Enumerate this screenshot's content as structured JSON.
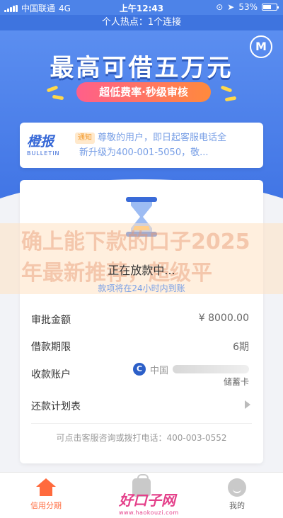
{
  "status_bar": {
    "carrier": "中国联通",
    "network": "4G",
    "time": "上午12:43",
    "battery": "53%"
  },
  "hotspot": "个人热点：1个连接",
  "banner": {
    "title": "最高可借五万元",
    "subtitle": "超低费率·秒级审核",
    "logo_letter": "M"
  },
  "bulletin": {
    "brand": "橙报",
    "brand_en": "BULLETIN",
    "tag": "通知",
    "text_line1": "尊敬的用户，即日起客服电话全",
    "text_line2": "新升级为400-001-5050，敬..."
  },
  "watermark": "确上能下款的口子2025年最新推荐，超级平",
  "loan": {
    "status": "正在放款中...",
    "subtitle": "款项将在24小时内到账",
    "amount_label": "审批金额",
    "amount_value": "¥ 8000.00",
    "term_label": "借款期限",
    "term_value": "6期",
    "account_label": "收款账户",
    "account_bank": "中国",
    "account_type": "储蓄卡",
    "plan_label": "还款计划表",
    "service_text": "可点击客服咨询或拨打电话：400-003-0552"
  },
  "tabs": [
    {
      "label": "信用分期",
      "icon": "house-icon",
      "active": true
    },
    {
      "label": "",
      "icon": "bag-icon",
      "active": false
    },
    {
      "label": "我的",
      "icon": "face-icon",
      "active": false
    }
  ],
  "site_logo": {
    "text": "好口子网",
    "url_text": "www.haokouzi.com"
  },
  "colors": {
    "primary": "#4d83e8",
    "accent": "#ff6a3d",
    "link": "#7aa0e6"
  }
}
